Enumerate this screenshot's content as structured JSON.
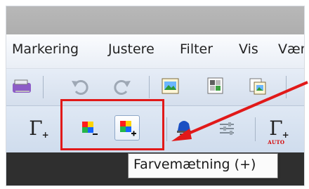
{
  "menu": {
    "items": [
      "Markering",
      "Justere",
      "Filter",
      "Vis",
      "Værk"
    ]
  },
  "toolbar": {
    "gamma_plus_label": "Γ",
    "gamma_plus_suffix": "+",
    "gamma_auto_label": "Γ",
    "gamma_auto_suffix": "+",
    "gamma_auto_caption": "AUTO"
  },
  "tooltip": {
    "text": "Farvemætning (+)"
  },
  "colors": {
    "highlight": "#e11919",
    "arrow": "#e11919"
  }
}
